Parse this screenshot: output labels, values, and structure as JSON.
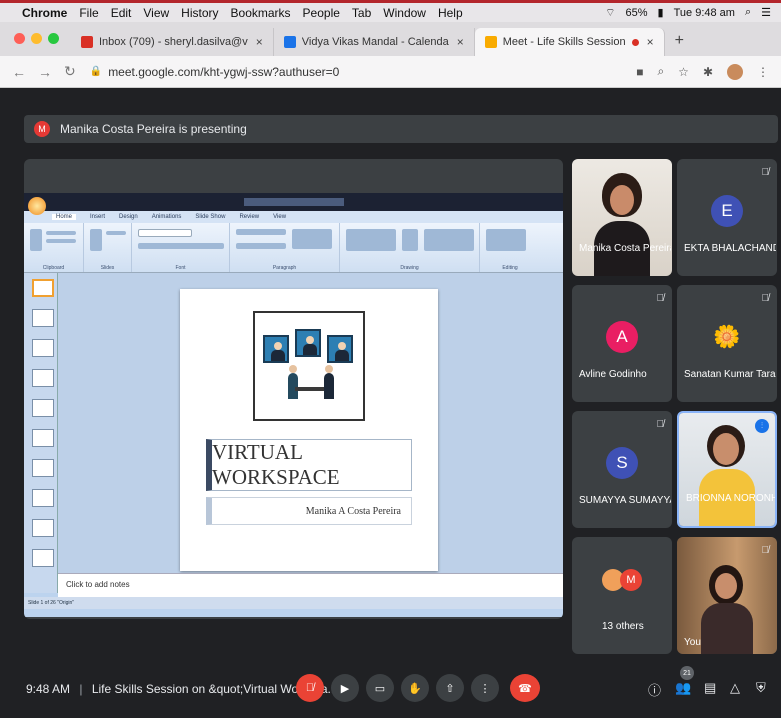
{
  "mac_menu": {
    "app": "Chrome",
    "items": [
      "File",
      "Edit",
      "View",
      "History",
      "Bookmarks",
      "People",
      "Tab",
      "Window",
      "Help"
    ],
    "battery": "65%",
    "clock": "Tue 9:48 am"
  },
  "tabs": [
    {
      "title": "Inbox (709) - sheryl.dasilva@v",
      "icon": "gmail-icon",
      "color": "#d93025"
    },
    {
      "title": "Vidya Vikas Mandal - Calenda",
      "icon": "calendar-icon",
      "color": "#1a73e8"
    },
    {
      "title": "Meet - Life Skills Session",
      "icon": "meet-icon",
      "color": "#f9ab00"
    }
  ],
  "address": {
    "url": "meet.google.com/kht-ygwj-ssw?authuser=0"
  },
  "banner": {
    "avatar_letter": "M",
    "text": "Manika Costa Pereira is presenting"
  },
  "presentation": {
    "slide_title": "VIRTUAL WORKSPACE",
    "slide_subtitle": "Manika A Costa Pereira",
    "notes_placeholder": "Click to add notes",
    "ribbon_tabs": [
      "Home",
      "Insert",
      "Design",
      "Animations",
      "Slide Show",
      "Review",
      "View"
    ],
    "ribbon_groups": [
      "Clipboard",
      "Slides",
      "Font",
      "Paragraph",
      "Drawing",
      "Editing"
    ],
    "status": "Slide 1 of 26   \"Origin\""
  },
  "participants": [
    {
      "name": "Manika Costa Pereira",
      "type": "photo"
    },
    {
      "name": "EKTA BHALACHAND...",
      "letter": "E",
      "color": "#3f51b5",
      "muted": true
    },
    {
      "name": "Avline Godinho",
      "letter": "A",
      "color": "#e91e63",
      "muted": true
    },
    {
      "name": "Sanatan Kumar Tarai",
      "type": "flower",
      "muted": true
    },
    {
      "name": "SUMAYYA SUMAYYA",
      "letter": "S",
      "color": "#3f51b5",
      "muted": true
    },
    {
      "name": "BRIONNA NORONHA",
      "type": "photo",
      "speaking": true
    },
    {
      "name": "13 others",
      "letter": "M",
      "color": "#ea4335"
    },
    {
      "name": "You",
      "type": "photo",
      "muted": true
    }
  ],
  "bottom_bar": {
    "time": "9:48 AM",
    "separator": "|",
    "meeting_title": "Life Skills Session on &quot;Virtual Workspa...",
    "people_count": "21"
  }
}
